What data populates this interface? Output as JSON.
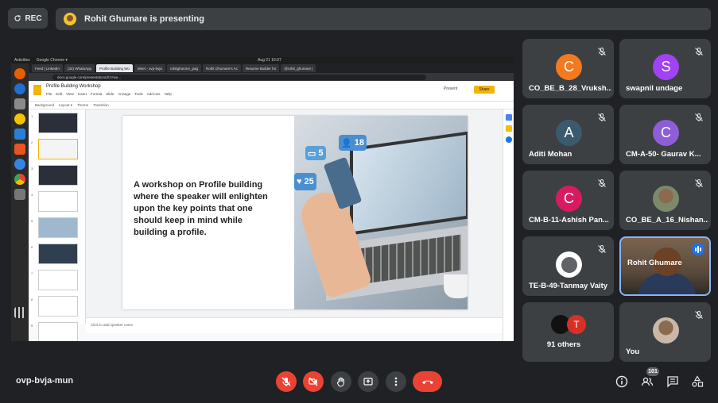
{
  "rec_button": {
    "label": "REC"
  },
  "presenting_bar": {
    "text": "Rohit Ghumare is presenting"
  },
  "shared_screen": {
    "ubuntu": {
      "activities": "Activities",
      "app": "Google Chrome ▾",
      "clock": "Aug 21  16:07"
    },
    "chrome_tabs": [
      "Feed | LinkedIn",
      "(34) WhatsApp",
      "Profile Building Wo",
      "Meet - ovp-bvja",
      "rohitghu/one_pag",
      "Rohit Ghumare's Ac",
      "Resume Builder for",
      "@rohit_ghumare |"
    ],
    "url": "docs.google.com/presentation/d/1Ywe...",
    "slides": {
      "title": "Profile Building Workshop",
      "menu": [
        "File",
        "Edit",
        "View",
        "Insert",
        "Format",
        "Slide",
        "Arrange",
        "Tools",
        "Add-ons",
        "Help"
      ],
      "present_label": "Present",
      "share_label": "Share",
      "toolbar": [
        "Background",
        "Layout ▾",
        "Theme",
        "Transition"
      ],
      "slide_text": "A workshop on Profile building where the speaker will enlighten upon the key points that one should keep in mind while building a profile.",
      "speaker_notes": "Click to add speaker notes",
      "bubbles": {
        "comments": "5",
        "followers": "18",
        "likes": "25"
      },
      "thumb_numbers": [
        "1",
        "2",
        "3",
        "4",
        "5",
        "6",
        "7",
        "8",
        "9"
      ]
    }
  },
  "participants": [
    {
      "name": "CO_BE_B_28_Vruksh...",
      "initial": "C",
      "color": "#f4791f"
    },
    {
      "name": "swapnil undage",
      "initial": "S",
      "color": "#a142f4"
    },
    {
      "name": "Aditi Mohan",
      "initial": "A",
      "color": "#3c5a6e"
    },
    {
      "name": "CM-A-50- Gaurav K...",
      "initial": "C",
      "color": "#8e5ed6"
    },
    {
      "name": "CM-B-11-Ashish Pan...",
      "initial": "C",
      "color": "#d81b60"
    },
    {
      "name": "CO_BE_A_16_Nishan...",
      "initial": "",
      "color": "#7a8a6a"
    },
    {
      "name": "TE-B-49-Tanmay Vaity",
      "initial": "",
      "color": "#ffffff"
    },
    {
      "name": "Rohit Ghumare",
      "initial": "",
      "color": ""
    },
    {
      "name": "91 others",
      "initial": "T",
      "color": "#d93025"
    },
    {
      "name": "You",
      "initial": "",
      "color": "#c9b8a8"
    }
  ],
  "bottom_bar": {
    "meeting_code": "ovp-bvja-mun",
    "participant_count": "101"
  }
}
